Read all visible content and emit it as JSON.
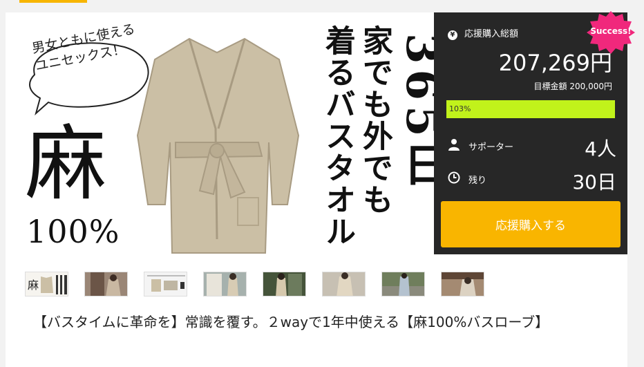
{
  "hero": {
    "bubble_line1": "男女ともに使える",
    "bubble_line2": "ユニセックス！",
    "big_kanji": "麻",
    "percent": "100%",
    "col1": "着るバスタオル",
    "col2": "家でも外でも",
    "col3": "365日"
  },
  "panel": {
    "total_label": "応援購入総額",
    "yen_icon": "¥",
    "amount": "207,269円",
    "goal": "目標金額 200,000円",
    "progress_label": "103%",
    "progress_fraction": 1.0,
    "supporters_label": "サポーター",
    "supporters_value": "4人",
    "remaining_label": "残り",
    "remaining_value": "30日",
    "buy_button": "応援購入する",
    "badge": "Success!"
  },
  "thumbnails": [
    {
      "name": "thumb-1"
    },
    {
      "name": "thumb-2"
    },
    {
      "name": "thumb-3"
    },
    {
      "name": "thumb-4"
    },
    {
      "name": "thumb-5"
    },
    {
      "name": "thumb-6"
    },
    {
      "name": "thumb-7"
    },
    {
      "name": "thumb-8"
    }
  ],
  "title": "【バスタイムに革命を】常識を覆す。２wayで1年中使える【麻100%バスローブ】",
  "colors": {
    "accent": "#f9b500",
    "progress": "#c1f21b",
    "panel_bg": "#272727",
    "badge": "#f0287c"
  }
}
